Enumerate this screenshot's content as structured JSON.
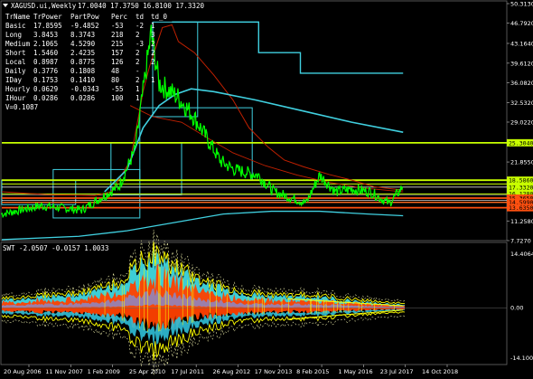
{
  "header": {
    "symbol_text": "XAGUSD.ui,Weekly",
    "ohlc_text": "17.0040 17.3750 16.8100 17.3320"
  },
  "info_table": {
    "headers": [
      "TrName",
      "TrPower",
      "PartPow",
      "Perc",
      "td",
      "td_0"
    ],
    "rows": [
      [
        "Basic",
        "17.8595",
        "-9.4852",
        "-53",
        "-2",
        "1"
      ],
      [
        "Long",
        "3.8453",
        "8.3743",
        "218",
        "2",
        "3"
      ],
      [
        "Medium",
        "2.1065",
        "4.5290",
        "215",
        "-3",
        "2"
      ],
      [
        "Short",
        "1.5460",
        "2.4235",
        "157",
        "2",
        "2"
      ],
      [
        "Local",
        "0.8987",
        "0.8775",
        "126",
        "2",
        "2"
      ],
      [
        "Daily",
        "0.3776",
        "0.1808",
        "48",
        "-",
        ""
      ],
      [
        "IDay",
        "0.1753",
        "0.1410",
        "80",
        "2",
        "1"
      ],
      [
        "Hourly",
        "0.0629",
        "-0.0343",
        "-55",
        "1",
        ""
      ],
      [
        "IHour",
        "0.0286",
        "0.0286",
        "100",
        "1",
        ""
      ]
    ],
    "footer": "V=0.1087"
  },
  "price_axis": {
    "ticks": [
      "50.3130",
      "46.7920",
      "43.1640",
      "39.6120",
      "36.0820",
      "32.5320",
      "29.0220",
      "25.3040",
      "21.8550",
      "18.5860",
      "16.1280",
      "11.2580",
      "7.7270"
    ]
  },
  "price_tags": [
    {
      "label": "25.3040",
      "value": 25.304,
      "color": "#c8ff00"
    },
    {
      "label": "18.5860",
      "value": 18.586,
      "color": "#c8ff00"
    },
    {
      "label": "17.3320",
      "value": 17.332,
      "color": "#c8ff00"
    },
    {
      "label": "16.1280",
      "value": 16.128,
      "color": "#c8ff00"
    },
    {
      "label": "15.3650",
      "value": 15.365,
      "color": "#ff5010"
    },
    {
      "label": "14.5990",
      "value": 14.599,
      "color": "#ff5010"
    },
    {
      "label": "13.6350",
      "value": 13.635,
      "color": "#ff5010"
    }
  ],
  "sub_panel": {
    "title": "SWT -2.0507 -0.0157 1.0033",
    "ticks": [
      "14.4064",
      "0.00",
      "-14.1002"
    ]
  },
  "time_axis": {
    "labels": [
      "20 Aug 2006",
      "11 Nov 2007",
      "1 Feb 2009",
      "25 Apr 2010",
      "17 Jul 2011",
      "26 Aug 2012",
      "17 Nov 2013",
      "8 Feb 2015",
      "1 May 2016",
      "23 Jul 2017",
      "14 Oct 2018"
    ]
  },
  "colors": {
    "price": "#00ff00",
    "cyan": "#40d0e0",
    "red": "#c02000",
    "yellow": "#ffff00",
    "orange": "#ff4000"
  },
  "chart_data": [
    {
      "type": "line",
      "title": "XAGUSD.ui,Weekly",
      "x": [
        "2006-08",
        "2007-11",
        "2009-02",
        "2010-04",
        "2010-10",
        "2011-04",
        "2011-07",
        "2012-02",
        "2012-08",
        "2013-06",
        "2013-11",
        "2014-08",
        "2015-02",
        "2016-02",
        "2016-07",
        "2017-01",
        "2017-07",
        "2018-02",
        "2018-09",
        "2019-02"
      ],
      "series": [
        {
          "name": "XAGUSD",
          "values": [
            12.5,
            14.0,
            13.2,
            17.5,
            24.0,
            45.0,
            36.0,
            33.5,
            30.0,
            22.0,
            20.5,
            19.5,
            16.5,
            14.5,
            19.5,
            16.5,
            17.0,
            16.5,
            14.4,
            17.33
          ]
        }
      ],
      "ylim": [
        7.727,
        50.313
      ]
    },
    {
      "type": "area",
      "title": "SWT -2.0507 -0.0157 1.0033",
      "x": [
        "2006-08",
        "2007-11",
        "2009-02",
        "2010-04",
        "2011-04",
        "2012-08",
        "2013-11",
        "2015-02",
        "2016-05",
        "2017-07",
        "2018-10",
        "2019-02"
      ],
      "series": [
        {
          "values": [
            2.0,
            3.0,
            3.5,
            6.0,
            13.5,
            7.5,
            4.0,
            3.0,
            3.0,
            2.0,
            1.0,
            1.0
          ]
        }
      ],
      "ylim": [
        -14.1002,
        14.4064
      ]
    }
  ]
}
